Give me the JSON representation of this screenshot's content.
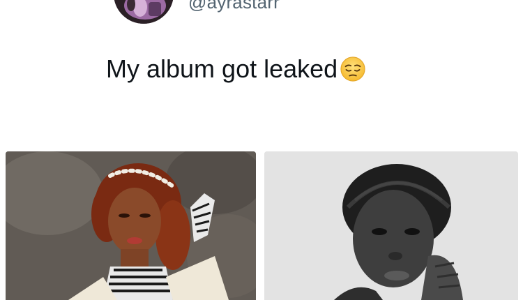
{
  "tweet": {
    "handle": "@ayrastarr",
    "text": "My album got leaked",
    "emoji": "pensive-face-emoji"
  },
  "media": [
    {
      "name": "photo-left",
      "tone": "color"
    },
    {
      "name": "photo-right",
      "tone": "grayscale"
    }
  ],
  "colors": {
    "text": "#0f1419",
    "handle": "#536471",
    "background": "#ffffff"
  }
}
